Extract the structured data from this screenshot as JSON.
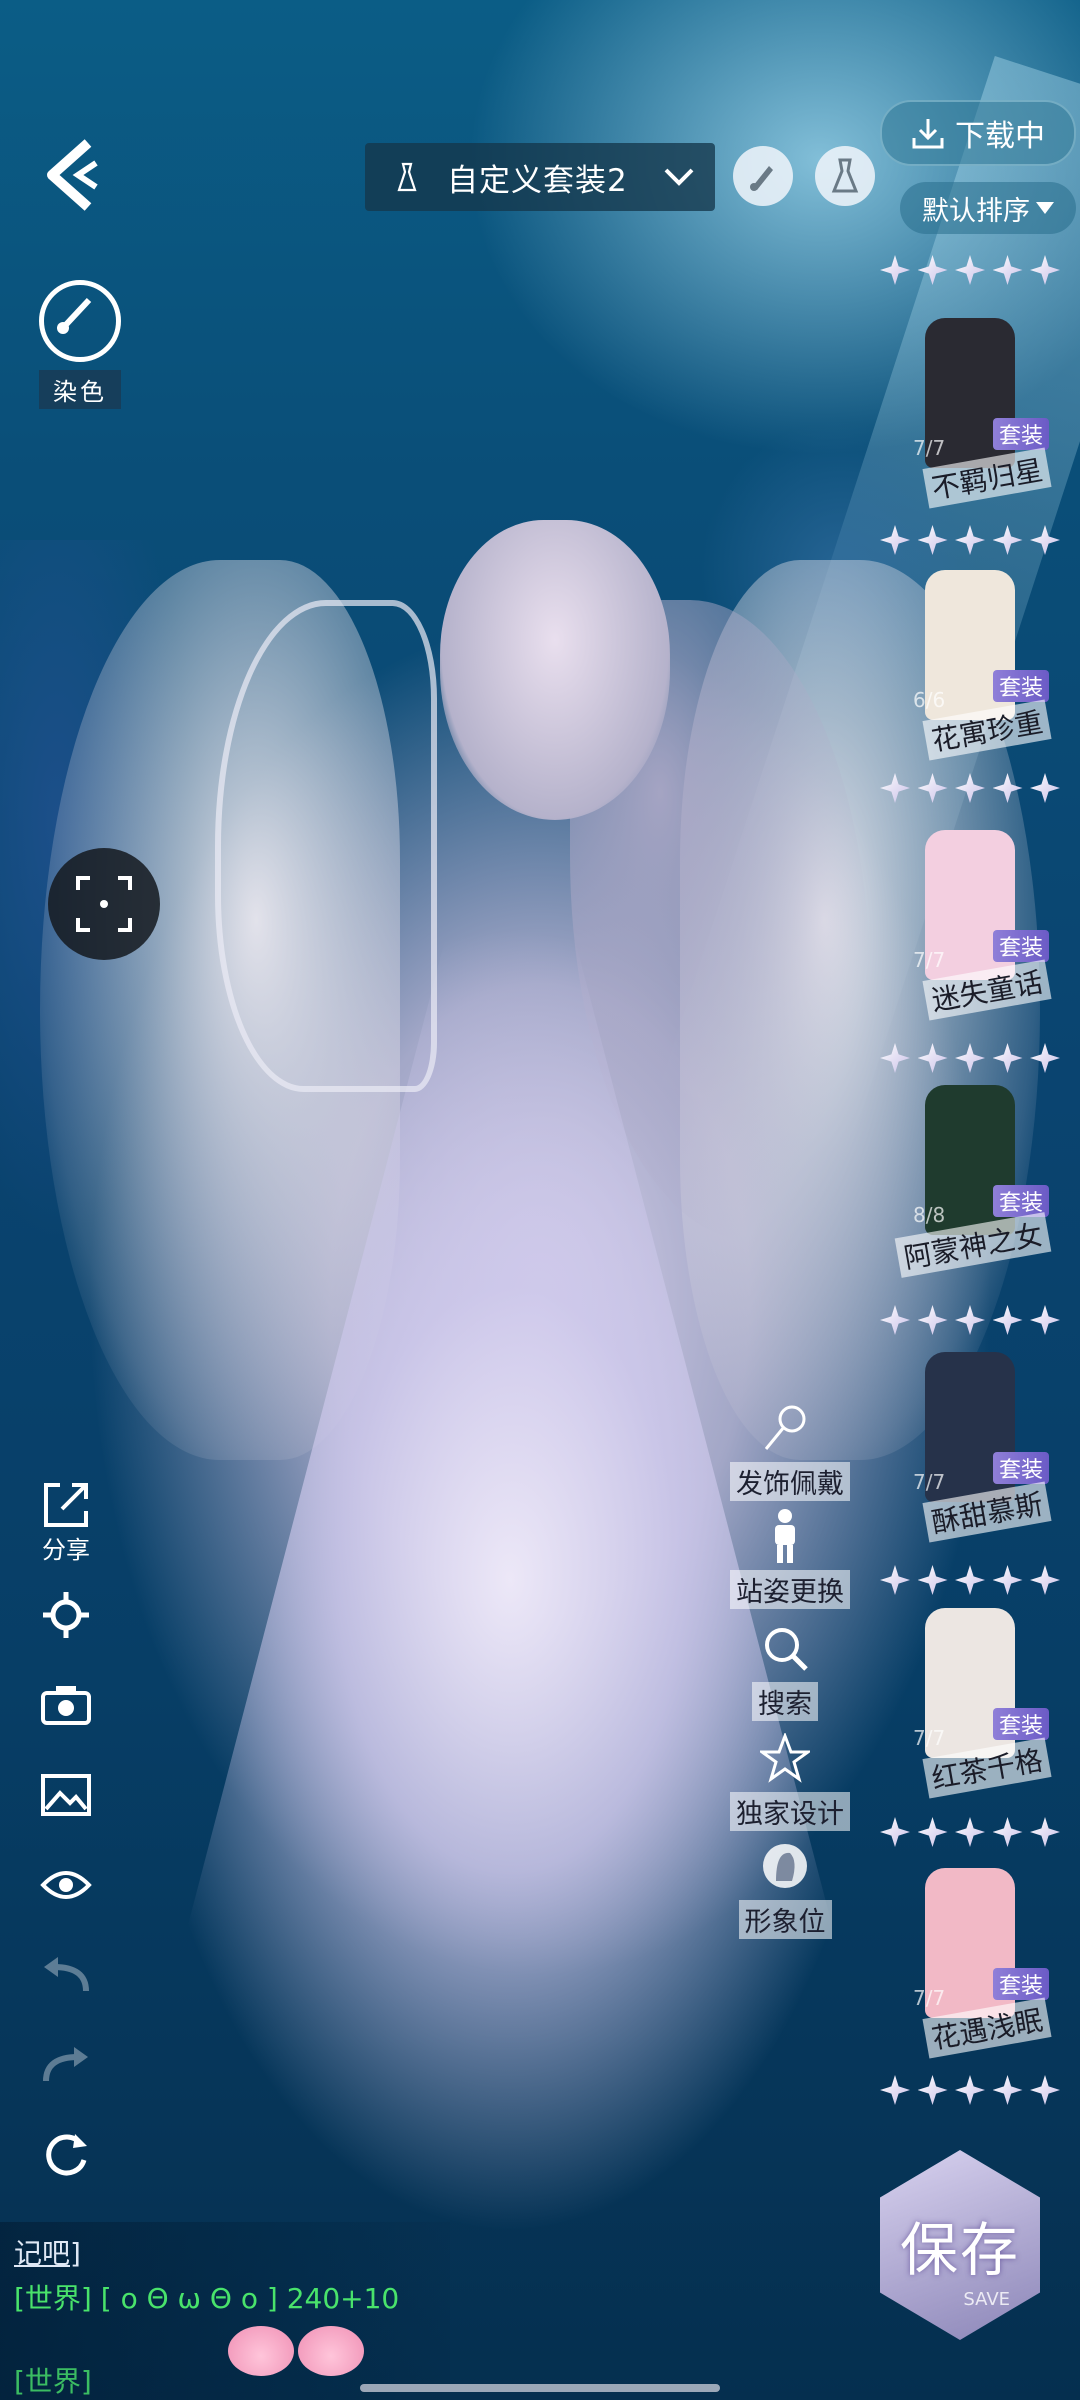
{
  "topbar": {
    "outfit_name": "自定义套装2",
    "download_label": "下载中",
    "sort_label": "默认排序"
  },
  "dye_label": "染色",
  "left_tools": {
    "share_label": "分享"
  },
  "actions": [
    {
      "label": "发饰佩戴",
      "icon": "hair-accessory-icon"
    },
    {
      "label": "站姿更换",
      "icon": "pose-icon"
    },
    {
      "label": "搜索",
      "icon": "search-icon"
    },
    {
      "label": "独家设计",
      "icon": "star-icon"
    },
    {
      "label": "形象位",
      "icon": "portrait-icon"
    }
  ],
  "outfits": [
    {
      "name": "不羁归星",
      "badge": "套装",
      "count": "7/7",
      "color": "#2a2a32"
    },
    {
      "name": "花寓珍重",
      "badge": "套装",
      "count": "6/6",
      "color": "#efe7dc"
    },
    {
      "name": "迷失童话",
      "badge": "套装",
      "count": "7/7",
      "color": "#f3cfe0"
    },
    {
      "name": "阿蒙神之女",
      "badge": "套装",
      "count": "8/8",
      "color": "#1f3b2e"
    },
    {
      "name": "酥甜慕斯",
      "badge": "套装",
      "count": "7/7",
      "color": "#26324a"
    },
    {
      "name": "红茶千格",
      "badge": "套装",
      "count": "7/7",
      "color": "#ece6e2"
    },
    {
      "name": "花遇浅眠",
      "badge": "套装",
      "count": "7/7",
      "color": "#f2b9c6"
    }
  ],
  "save": {
    "label": "保存",
    "sub": "SAVE"
  },
  "chat": {
    "link": "记吧]",
    "channel": "[世界]",
    "message": "[ o Θ ω Θ o ] 240+10",
    "channel2": "[世界]"
  }
}
